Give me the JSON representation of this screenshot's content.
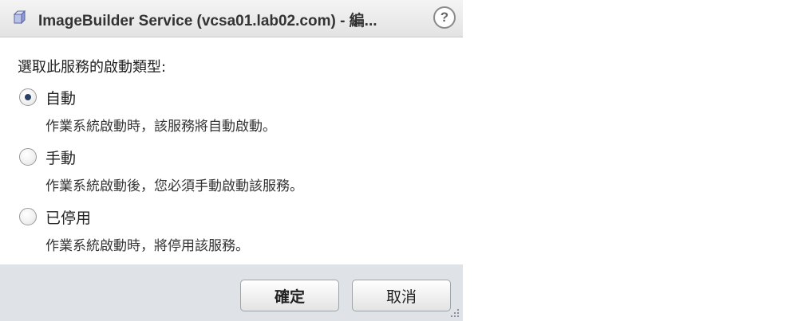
{
  "dialog": {
    "title": "ImageBuilder Service (vcsa01.lab02.com) - 編...",
    "help_label": "?",
    "prompt": "選取此服務的啟動類型:",
    "options": [
      {
        "label": "自動",
        "description": "作業系統啟動時，該服務將自動啟動。",
        "selected": true
      },
      {
        "label": "手動",
        "description": "作業系統啟動後，您必須手動啟動該服務。",
        "selected": false
      },
      {
        "label": "已停用",
        "description": "作業系統啟動時，將停用該服務。",
        "selected": false
      }
    ],
    "buttons": {
      "ok": "確定",
      "cancel": "取消"
    }
  },
  "icons": {
    "title_icon": "cube-icon",
    "resize": "resize-grip-icon"
  }
}
